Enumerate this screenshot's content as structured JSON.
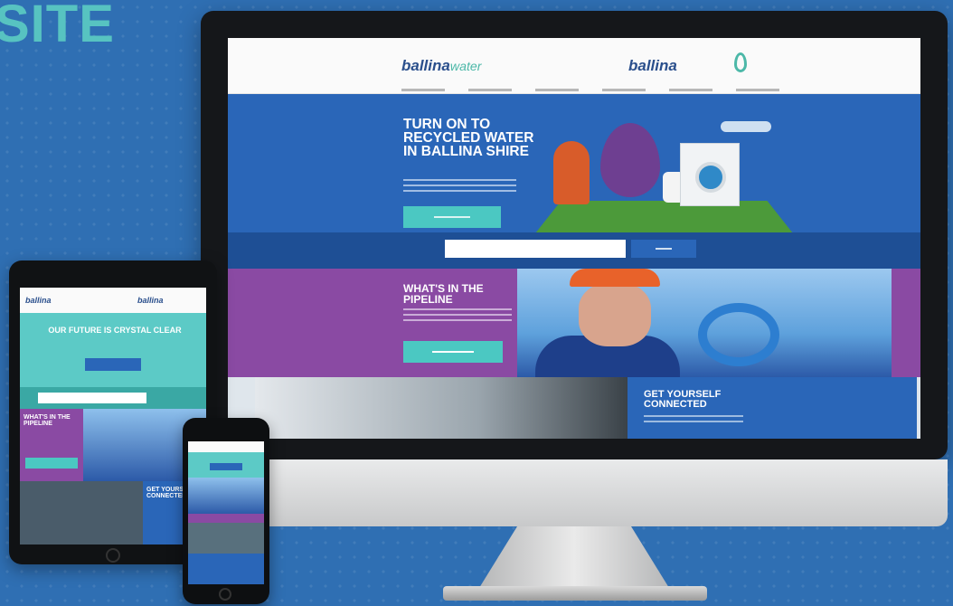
{
  "page": {
    "headline": "SITE",
    "colors": {
      "background": "#2f6fb3",
      "accent": "#57c3c1",
      "purple": "#8a4aa3",
      "blue": "#2a66b8"
    }
  },
  "desktop": {
    "logo_left": "ballina",
    "logo_left_suffix": "water",
    "logo_right": "ballina",
    "hero_title": "TURN ON TO RECYCLED WATER IN BALLINA SHIRE",
    "search_placeholder": "",
    "pipeline_title": "WHAT'S IN THE PIPELINE",
    "connect_title": "GET YOURSELF CONNECTED"
  },
  "tablet": {
    "logo_left": "ballina",
    "logo_right": "ballina",
    "hero_title": "OUR FUTURE IS CRYSTAL CLEAR",
    "pipeline_title": "WHAT'S IN THE PIPELINE",
    "connect_title": "GET YOURSELF CONNECTED"
  }
}
